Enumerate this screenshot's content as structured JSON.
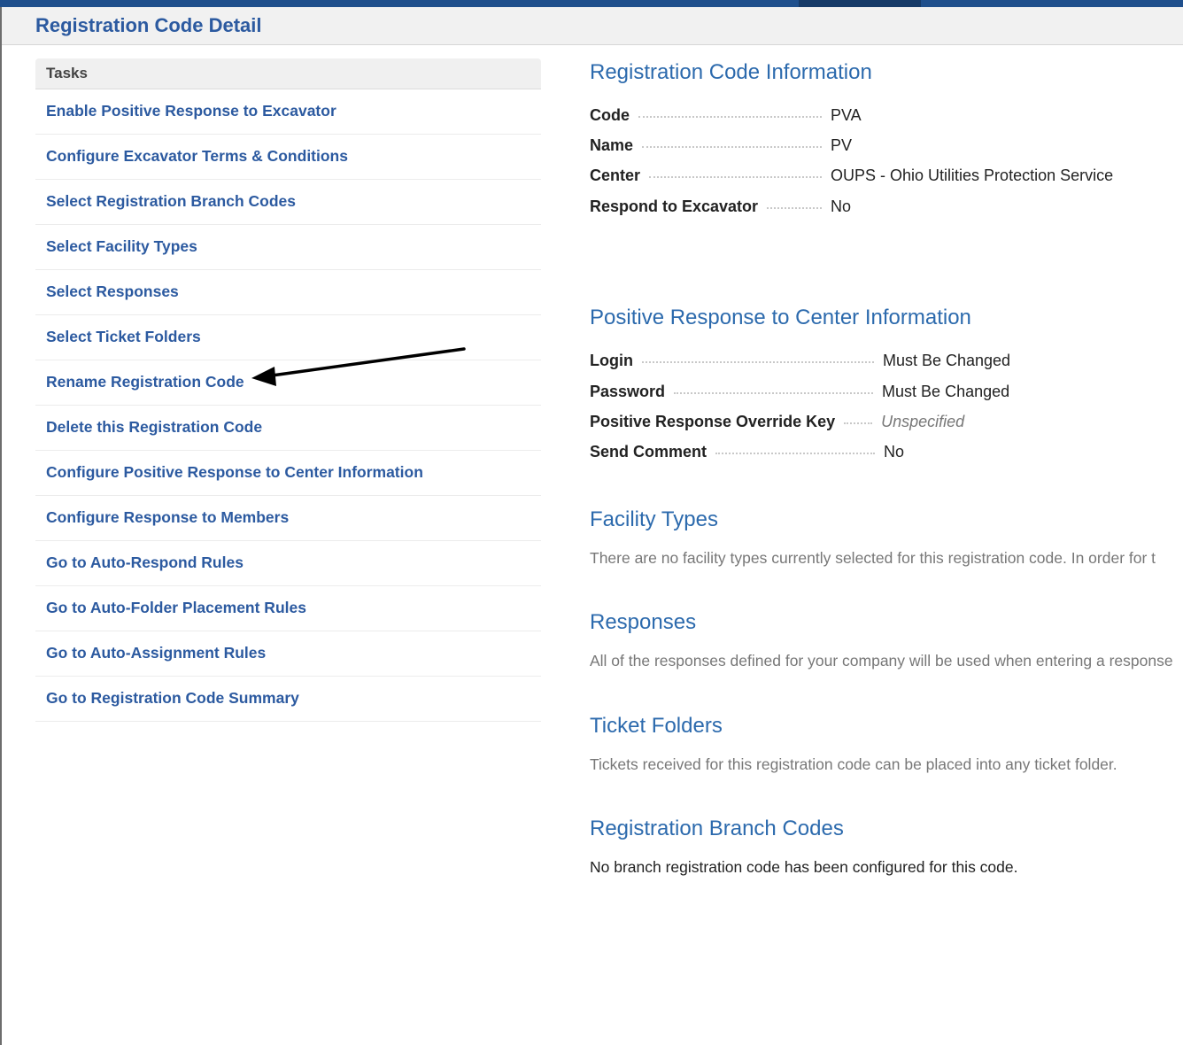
{
  "header": {
    "title": "Registration Code Detail"
  },
  "tasks": {
    "heading": "Tasks",
    "items": [
      {
        "label": "Enable Positive Response to Excavator"
      },
      {
        "label": "Configure Excavator Terms & Conditions"
      },
      {
        "label": "Select Registration Branch Codes"
      },
      {
        "label": "Select Facility Types"
      },
      {
        "label": "Select Responses"
      },
      {
        "label": "Select Ticket Folders"
      },
      {
        "label": "Rename Registration Code"
      },
      {
        "label": "Delete this Registration Code"
      },
      {
        "label": "Configure Positive Response to Center Information"
      },
      {
        "label": "Configure Response to Members"
      },
      {
        "label": "Go to Auto-Respond Rules"
      },
      {
        "label": "Go to Auto-Folder Placement Rules"
      },
      {
        "label": "Go to Auto-Assignment Rules"
      },
      {
        "label": "Go to Registration Code Summary"
      }
    ]
  },
  "registration_info": {
    "title": "Registration Code Information",
    "rows": [
      {
        "label": "Code",
        "value": "PVA"
      },
      {
        "label": "Name",
        "value": "PV"
      },
      {
        "label": "Center",
        "value": "OUPS - Ohio Utilities Protection Service"
      },
      {
        "label": "Respond to Excavator",
        "value": "No"
      }
    ]
  },
  "positive_response": {
    "title": "Positive Response to Center Information",
    "rows": [
      {
        "label": "Login",
        "value": "Must Be Changed"
      },
      {
        "label": "Password",
        "value": "Must Be Changed"
      },
      {
        "label": "Positive Response Override Key",
        "value": "Unspecified"
      },
      {
        "label": "Send Comment",
        "value": "No"
      }
    ]
  },
  "facility_types": {
    "title": "Facility Types",
    "text": "There are no facility types currently selected for this registration code.   In order for t"
  },
  "responses": {
    "title": "Responses",
    "text": "All of the responses defined for your company will be used when entering a response"
  },
  "ticket_folders": {
    "title": "Ticket Folders",
    "text": "Tickets received for this registration code can be placed into any ticket folder."
  },
  "branch_codes": {
    "title": "Registration Branch Codes",
    "text": "No branch registration code has been configured for this code."
  },
  "colors": {
    "link": "#2c5aa0",
    "heading": "#2c6aad",
    "top_bar": "#1f4f8c"
  },
  "annotation": {
    "icon": "arrow-icon"
  }
}
